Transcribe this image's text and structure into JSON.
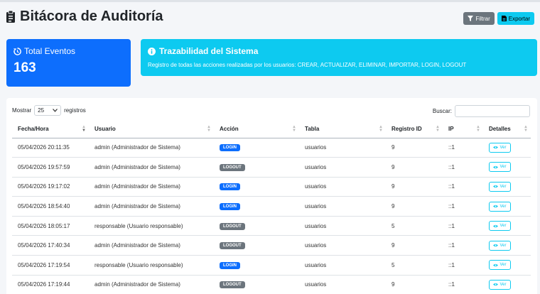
{
  "header": {
    "title": "Bitácora de Auditoría",
    "filter_label": "Filtrar",
    "export_label": "Exportar"
  },
  "total_card": {
    "label": "Total Eventos",
    "value": "163"
  },
  "trace_card": {
    "title": "Trazabilidad del Sistema",
    "description": "Registro de todas las acciones realizadas por los usuarios: CREAR, ACTUALIZAR, ELIMINAR, IMPORTAR, LOGIN, LOGOUT"
  },
  "table_controls": {
    "show_label": "Mostrar",
    "page_size": "25",
    "records_label": "registros",
    "search_label": "Buscar:"
  },
  "columns": [
    "Fecha/Hora",
    "Usuario",
    "Acción",
    "Tabla",
    "Registro ID",
    "IP",
    "Detalles"
  ],
  "rows": [
    {
      "fecha": "05/04/2026 20:11:35",
      "usuario": "admin (Administrador de Sistema)",
      "accion": "LOGIN",
      "tabla": "usuarios",
      "registro": "9",
      "ip": "::1",
      "detalle": "Ver"
    },
    {
      "fecha": "05/04/2026 19:57:59",
      "usuario": "admin (Administrador de Sistema)",
      "accion": "LOGOUT",
      "tabla": "usuarios",
      "registro": "9",
      "ip": "::1",
      "detalle": "Ver"
    },
    {
      "fecha": "05/04/2026 19:17:02",
      "usuario": "admin (Administrador de Sistema)",
      "accion": "LOGIN",
      "tabla": "usuarios",
      "registro": "9",
      "ip": "::1",
      "detalle": "Ver"
    },
    {
      "fecha": "05/04/2026 18:54:40",
      "usuario": "admin (Administrador de Sistema)",
      "accion": "LOGIN",
      "tabla": "usuarios",
      "registro": "9",
      "ip": "::1",
      "detalle": "Ver"
    },
    {
      "fecha": "05/04/2026 18:05:17",
      "usuario": "responsable (Usuario responsable)",
      "accion": "LOGOUT",
      "tabla": "usuarios",
      "registro": "5",
      "ip": "::1",
      "detalle": "Ver"
    },
    {
      "fecha": "05/04/2026 17:40:34",
      "usuario": "admin (Administrador de Sistema)",
      "accion": "LOGOUT",
      "tabla": "usuarios",
      "registro": "9",
      "ip": "::1",
      "detalle": "Ver"
    },
    {
      "fecha": "05/04/2026 17:19:54",
      "usuario": "responsable (Usuario responsable)",
      "accion": "LOGIN",
      "tabla": "usuarios",
      "registro": "5",
      "ip": "::1",
      "detalle": "Ver"
    },
    {
      "fecha": "05/04/2026 17:19:44",
      "usuario": "admin (Administrador de Sistema)",
      "accion": "LOGOUT",
      "tabla": "usuarios",
      "registro": "9",
      "ip": "::1",
      "detalle": "Ver"
    }
  ],
  "colors": {
    "primary": "#0d6efd",
    "info": "#0dcaf0",
    "secondary": "#6c757d"
  },
  "icons": {
    "title": "clipboard-list-icon",
    "filter": "filter-icon",
    "export": "file-export-icon",
    "total": "history-icon",
    "trace": "info-circle-icon",
    "ver": "eye-icon"
  }
}
